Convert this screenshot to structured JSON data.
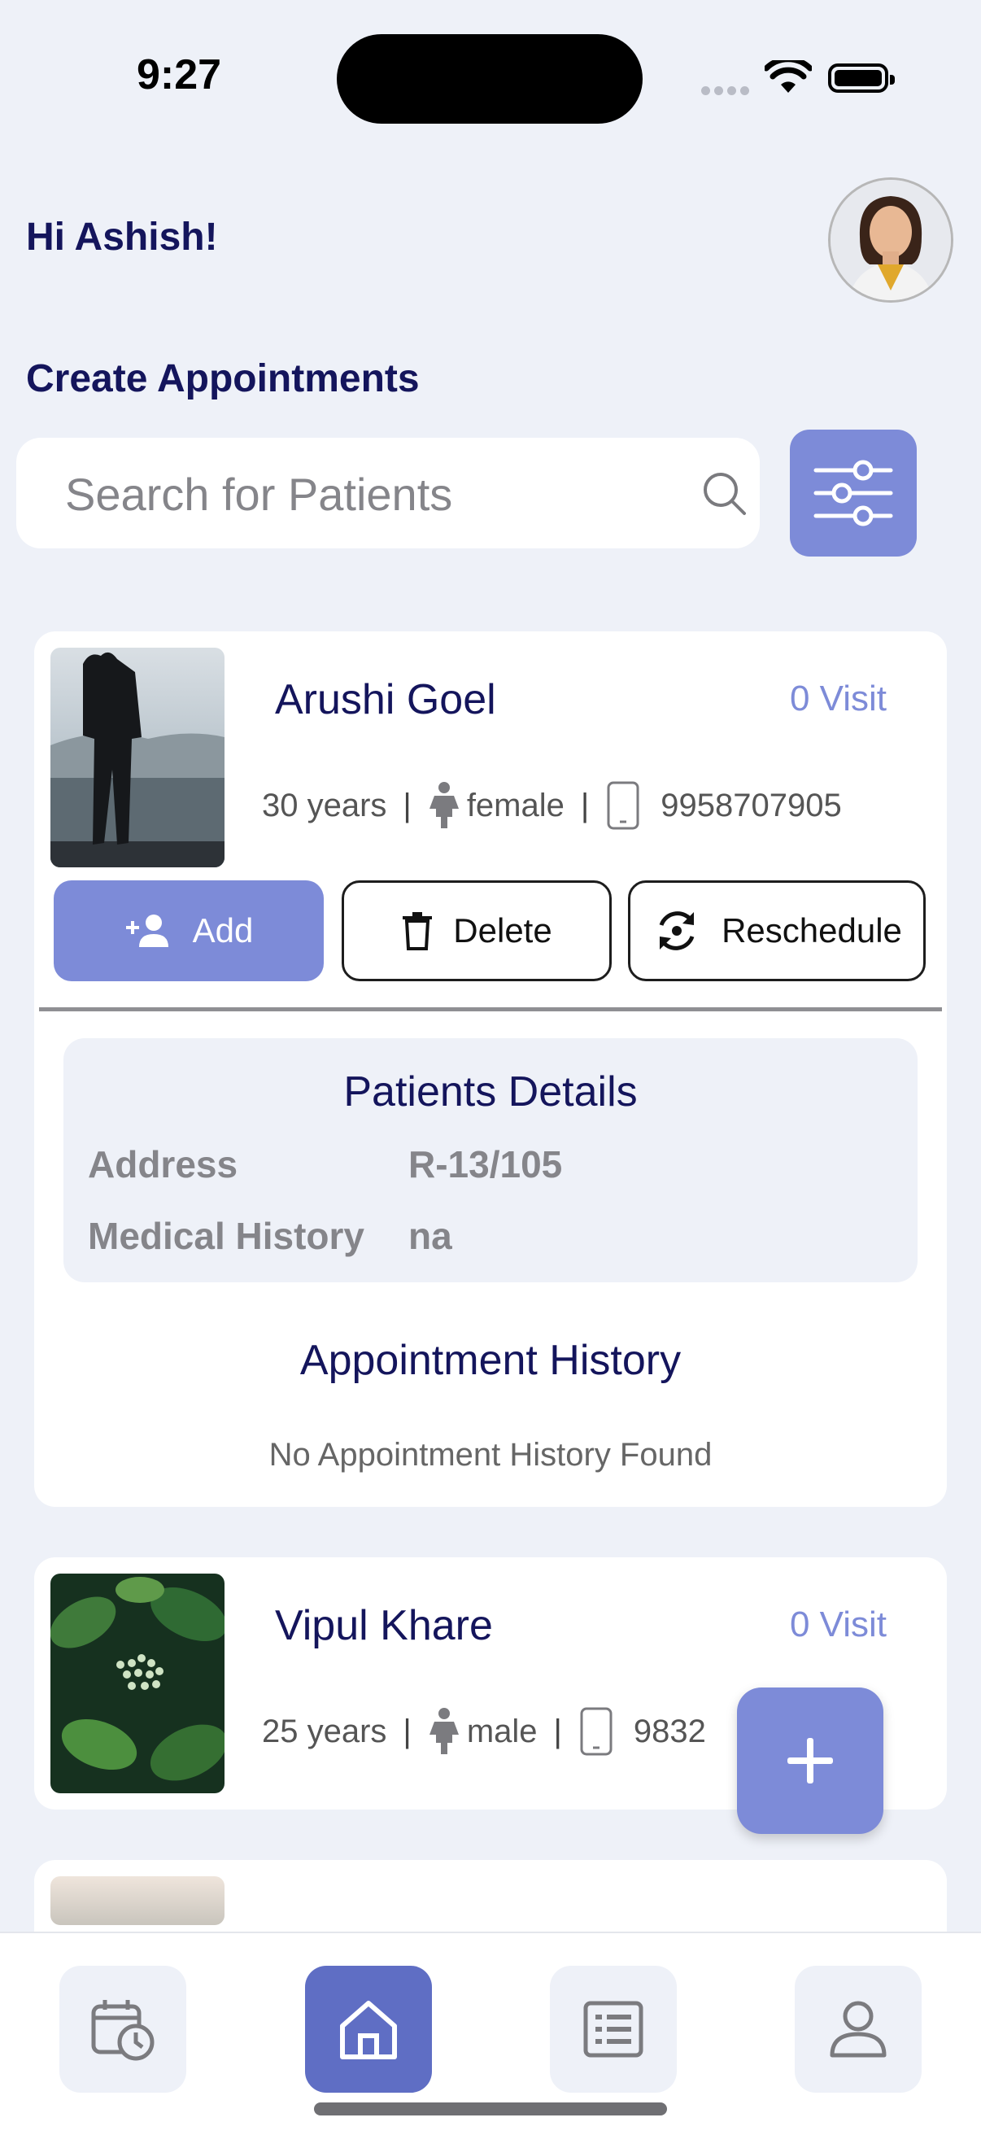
{
  "status_bar": {
    "time": "9:27"
  },
  "header": {
    "greeting": "Hi Ashish!",
    "section_title": "Create Appointments"
  },
  "search": {
    "placeholder": "Search for Patients"
  },
  "patients": [
    {
      "name": "Arushi  Goel",
      "visits": "0 Visit",
      "age": "30 years",
      "gender": "female",
      "phone": "9958707905",
      "actions": {
        "add": "Add",
        "delete": "Delete",
        "reschedule": "Reschedule"
      },
      "details": {
        "title": "Patients Details",
        "address_label": "Address",
        "address_value": "R-13/105",
        "history_label": "Medical History",
        "history_value": "na"
      },
      "appointment_history": {
        "title": "Appointment History",
        "empty_text": "No Appointment History Found"
      }
    },
    {
      "name": "Vipul  Khare",
      "visits": "0 Visit",
      "age": "25 years",
      "gender": "male",
      "phone": "9832"
    }
  ],
  "colors": {
    "accent": "#7d8bd8",
    "nav_active": "#5f6ec4",
    "title": "#14155c",
    "background": "#eef1f8"
  },
  "icons": {
    "filter": "sliders-icon",
    "search": "search-icon",
    "fab": "plus-icon",
    "nav": [
      "calendar-clock-icon",
      "home-icon",
      "list-icon",
      "user-icon"
    ]
  }
}
